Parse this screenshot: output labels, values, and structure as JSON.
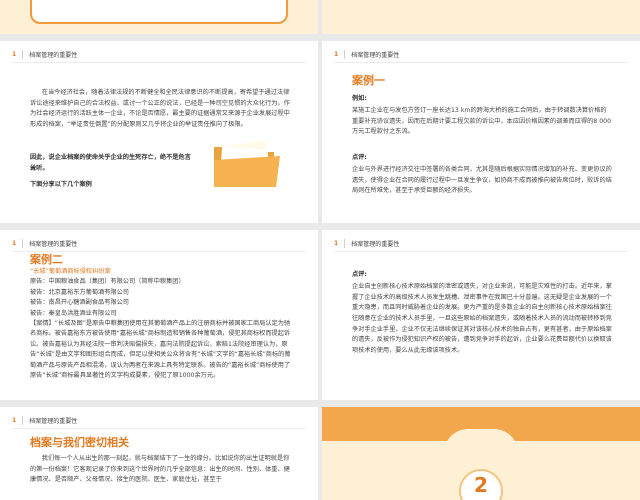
{
  "colors": {
    "accent": "#e07a22",
    "cream": "#fdf0d5",
    "bar": "#f2a74d",
    "frame": "#ef9b3e"
  },
  "icons": {
    "folder": "folder-icon"
  },
  "header": {
    "num": "1",
    "title": "档案管理的重要性"
  },
  "slide_right_top": {
    "title": "案例一",
    "example_label": "例如:",
    "example_text": "某施工企业在与发包方签订一座长达13 km的跨海大桥的施工合同后，由于转调数决算价格的重要补充协议遗失，因而在后期计要工程欠款的诉讼中，本应因价格因素的调差而应得的8 000万元工程款付之东流。",
    "comment_label": "点评:",
    "comment_text": "企业与外界进行经济交往中签署的各类合同，尤其是随后根据实际情况增加的补充、变更协议的遗失，使得企业在合同的履行过程中一旦发生争议，如协商不成而被推向被告席位时，败诉的结局则在所难免，甚至于承受巨额的经济损失。"
  },
  "slide_left_top": {
    "p1": "在当今经济社会，随着法律法规的不断健全和全民法律意识的不断提高，寄希望于通过法律诉讼途径来维护自己的合法权益、或讨一个公正的说法，已经是一种司空见惯的大众化行为。作为社会经济运行的活跃主体一企业，不论是否情愿，最主要的证据通常又来源于企业发展过程中形成的档案，“举证责任倒置”的分配原则又几乎将企业的举证责任推向了极限。",
    "p2": "因此，说企业档案的使命关乎企业的生死存亡，绝不是危言耸听。",
    "p3": "下面分享以下几个案例"
  },
  "slide_left_mid": {
    "title": "案例二",
    "case_title": "“长城”葡萄酒商标侵权纠纷案",
    "lines": [
      "原告：中国粮油食品（集团）有限公司（简称中粮集团）",
      "被告：北京嘉裕东方葡萄酒有限公司",
      "被告：南昌开心糖酒副食品有限公司",
      "被告：秦皇岛洪胜酒业有限公司"
    ],
    "facts": "【案情】“长城及图”是原告中粮集团使用在其葡萄酒产品上的注册商标并被国家工商局认定为驰名商标。被告嘉裕东方被告使用“嘉裕长城”商标制造和销售各种葡萄酒，侵犯其商标权而提起诉讼。被告嘉裕认为其经法院一审判决赔偿损失，嘉向法院提起诉讼，索赔1法院经审理认为，原告“长城”是由文字和图形组合而成，但足以使相关公众将含有“长城”文字的“嘉裕长城”商标的葡萄酒产品与原告产品相混淆，误认为两者在来源上具有特定联系。被告的“嘉裕长城”商标使用了原告“长城”商标最具显著性的文字构成要素，侵犯了原1000余万元。"
  },
  "slide_right_mid": {
    "comment_label": "点评:",
    "comment_text": "企业自主创新核心技术原始档案的泄密或遗失，对企业来说，可能是灾难性的打击。近年来，掌握了企业技术的高级技术人员发生跳槽、泄密事件在我国已十分普遍。这无疑是企业发展的一个重大隐患，而且同时威胁着企业的发展。更为严重的是多数企业的自主创新核心技术原始档案往往随意在企业的技术人员手里，一旦这些原始的档案遗失，或随着技术人员的流动而被转移到竞争对手企业手里，企业不仅无法继续保证其对该核心技术的独自占有，更有甚者，由于原始档案的遗失，反被作为侵犯知识产权的被告，遭到竞争对手的起诉，企业要么花费巨额代价以换取该项技术的使用，要么从此无缘该项技术。"
  },
  "slide_left_bot": {
    "title": "档案与我们密切相关",
    "text": "我们每一个人从出生的那一刻起，就与档案结下了一生的缘分。比如说你的出生证明就是你的第一份档案！它客观记录了你来到这个世界时的几乎全部信息：出生的时间、性别、体重、健康情况、是否顺产、父母情况、接生的医院、医生、家庭住址，甚至于"
  },
  "slide_right_bot": {
    "section_number": "2"
  }
}
